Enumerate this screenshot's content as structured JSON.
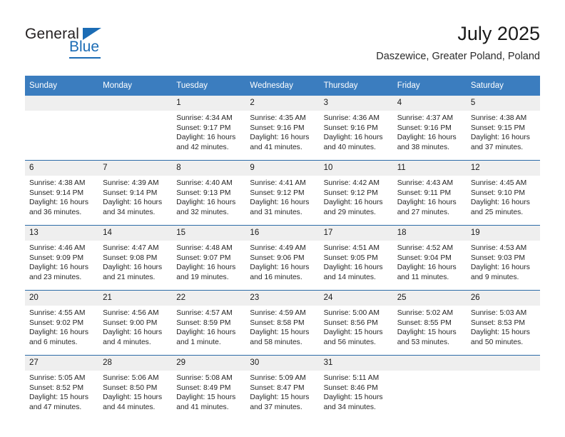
{
  "brand": {
    "name_part1": "General",
    "name_part2": "Blue",
    "accent_color": "#1b6cb5"
  },
  "header": {
    "title": "July 2025",
    "subtitle": "Daszewice, Greater Poland, Poland"
  },
  "calendar": {
    "header_bg": "#3b7dbf",
    "daynum_bg": "#efefef",
    "row_rule_color": "#2d6ca8",
    "weekday_headers": [
      "Sunday",
      "Monday",
      "Tuesday",
      "Wednesday",
      "Thursday",
      "Friday",
      "Saturday"
    ],
    "weeks": [
      [
        {
          "day": "",
          "sunrise": "",
          "sunset": "",
          "daylight": ""
        },
        {
          "day": "",
          "sunrise": "",
          "sunset": "",
          "daylight": ""
        },
        {
          "day": "1",
          "sunrise": "Sunrise: 4:34 AM",
          "sunset": "Sunset: 9:17 PM",
          "daylight": "Daylight: 16 hours and 42 minutes."
        },
        {
          "day": "2",
          "sunrise": "Sunrise: 4:35 AM",
          "sunset": "Sunset: 9:16 PM",
          "daylight": "Daylight: 16 hours and 41 minutes."
        },
        {
          "day": "3",
          "sunrise": "Sunrise: 4:36 AM",
          "sunset": "Sunset: 9:16 PM",
          "daylight": "Daylight: 16 hours and 40 minutes."
        },
        {
          "day": "4",
          "sunrise": "Sunrise: 4:37 AM",
          "sunset": "Sunset: 9:16 PM",
          "daylight": "Daylight: 16 hours and 38 minutes."
        },
        {
          "day": "5",
          "sunrise": "Sunrise: 4:38 AM",
          "sunset": "Sunset: 9:15 PM",
          "daylight": "Daylight: 16 hours and 37 minutes."
        }
      ],
      [
        {
          "day": "6",
          "sunrise": "Sunrise: 4:38 AM",
          "sunset": "Sunset: 9:14 PM",
          "daylight": "Daylight: 16 hours and 36 minutes."
        },
        {
          "day": "7",
          "sunrise": "Sunrise: 4:39 AM",
          "sunset": "Sunset: 9:14 PM",
          "daylight": "Daylight: 16 hours and 34 minutes."
        },
        {
          "day": "8",
          "sunrise": "Sunrise: 4:40 AM",
          "sunset": "Sunset: 9:13 PM",
          "daylight": "Daylight: 16 hours and 32 minutes."
        },
        {
          "day": "9",
          "sunrise": "Sunrise: 4:41 AM",
          "sunset": "Sunset: 9:12 PM",
          "daylight": "Daylight: 16 hours and 31 minutes."
        },
        {
          "day": "10",
          "sunrise": "Sunrise: 4:42 AM",
          "sunset": "Sunset: 9:12 PM",
          "daylight": "Daylight: 16 hours and 29 minutes."
        },
        {
          "day": "11",
          "sunrise": "Sunrise: 4:43 AM",
          "sunset": "Sunset: 9:11 PM",
          "daylight": "Daylight: 16 hours and 27 minutes."
        },
        {
          "day": "12",
          "sunrise": "Sunrise: 4:45 AM",
          "sunset": "Sunset: 9:10 PM",
          "daylight": "Daylight: 16 hours and 25 minutes."
        }
      ],
      [
        {
          "day": "13",
          "sunrise": "Sunrise: 4:46 AM",
          "sunset": "Sunset: 9:09 PM",
          "daylight": "Daylight: 16 hours and 23 minutes."
        },
        {
          "day": "14",
          "sunrise": "Sunrise: 4:47 AM",
          "sunset": "Sunset: 9:08 PM",
          "daylight": "Daylight: 16 hours and 21 minutes."
        },
        {
          "day": "15",
          "sunrise": "Sunrise: 4:48 AM",
          "sunset": "Sunset: 9:07 PM",
          "daylight": "Daylight: 16 hours and 19 minutes."
        },
        {
          "day": "16",
          "sunrise": "Sunrise: 4:49 AM",
          "sunset": "Sunset: 9:06 PM",
          "daylight": "Daylight: 16 hours and 16 minutes."
        },
        {
          "day": "17",
          "sunrise": "Sunrise: 4:51 AM",
          "sunset": "Sunset: 9:05 PM",
          "daylight": "Daylight: 16 hours and 14 minutes."
        },
        {
          "day": "18",
          "sunrise": "Sunrise: 4:52 AM",
          "sunset": "Sunset: 9:04 PM",
          "daylight": "Daylight: 16 hours and 11 minutes."
        },
        {
          "day": "19",
          "sunrise": "Sunrise: 4:53 AM",
          "sunset": "Sunset: 9:03 PM",
          "daylight": "Daylight: 16 hours and 9 minutes."
        }
      ],
      [
        {
          "day": "20",
          "sunrise": "Sunrise: 4:55 AM",
          "sunset": "Sunset: 9:02 PM",
          "daylight": "Daylight: 16 hours and 6 minutes."
        },
        {
          "day": "21",
          "sunrise": "Sunrise: 4:56 AM",
          "sunset": "Sunset: 9:00 PM",
          "daylight": "Daylight: 16 hours and 4 minutes."
        },
        {
          "day": "22",
          "sunrise": "Sunrise: 4:57 AM",
          "sunset": "Sunset: 8:59 PM",
          "daylight": "Daylight: 16 hours and 1 minute."
        },
        {
          "day": "23",
          "sunrise": "Sunrise: 4:59 AM",
          "sunset": "Sunset: 8:58 PM",
          "daylight": "Daylight: 15 hours and 58 minutes."
        },
        {
          "day": "24",
          "sunrise": "Sunrise: 5:00 AM",
          "sunset": "Sunset: 8:56 PM",
          "daylight": "Daylight: 15 hours and 56 minutes."
        },
        {
          "day": "25",
          "sunrise": "Sunrise: 5:02 AM",
          "sunset": "Sunset: 8:55 PM",
          "daylight": "Daylight: 15 hours and 53 minutes."
        },
        {
          "day": "26",
          "sunrise": "Sunrise: 5:03 AM",
          "sunset": "Sunset: 8:53 PM",
          "daylight": "Daylight: 15 hours and 50 minutes."
        }
      ],
      [
        {
          "day": "27",
          "sunrise": "Sunrise: 5:05 AM",
          "sunset": "Sunset: 8:52 PM",
          "daylight": "Daylight: 15 hours and 47 minutes."
        },
        {
          "day": "28",
          "sunrise": "Sunrise: 5:06 AM",
          "sunset": "Sunset: 8:50 PM",
          "daylight": "Daylight: 15 hours and 44 minutes."
        },
        {
          "day": "29",
          "sunrise": "Sunrise: 5:08 AM",
          "sunset": "Sunset: 8:49 PM",
          "daylight": "Daylight: 15 hours and 41 minutes."
        },
        {
          "day": "30",
          "sunrise": "Sunrise: 5:09 AM",
          "sunset": "Sunset: 8:47 PM",
          "daylight": "Daylight: 15 hours and 37 minutes."
        },
        {
          "day": "31",
          "sunrise": "Sunrise: 5:11 AM",
          "sunset": "Sunset: 8:46 PM",
          "daylight": "Daylight: 15 hours and 34 minutes."
        },
        {
          "day": "",
          "sunrise": "",
          "sunset": "",
          "daylight": ""
        },
        {
          "day": "",
          "sunrise": "",
          "sunset": "",
          "daylight": ""
        }
      ]
    ]
  }
}
